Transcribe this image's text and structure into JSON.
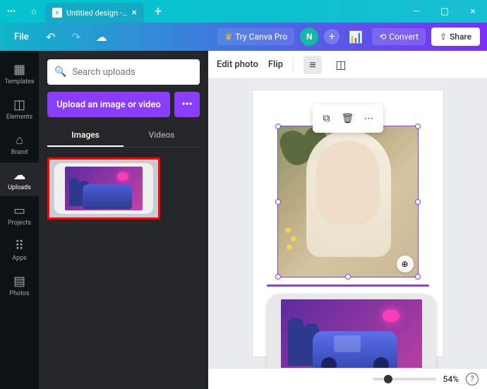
{
  "titlebar": {
    "tab_title": "Untitled design - D...",
    "menu_dots": "•••",
    "close": "×",
    "new_tab": "+",
    "minimize": "—",
    "maximize": "▢",
    "win_close": "×"
  },
  "toolbar": {
    "file": "File",
    "try_pro": "Try Canva Pro",
    "avatar_letter": "N",
    "convert": "Convert",
    "share": "Share"
  },
  "rail": {
    "items": [
      {
        "icon": "▦",
        "label": "Templates"
      },
      {
        "icon": "◫",
        "label": "Elements"
      },
      {
        "icon": "⌂",
        "label": "Brand"
      },
      {
        "icon": "☁",
        "label": "Uploads"
      },
      {
        "icon": "▭",
        "label": "Projects"
      },
      {
        "icon": "⠿",
        "label": "Apps"
      },
      {
        "icon": "▤",
        "label": "Photos"
      }
    ],
    "active_index": 3
  },
  "panel": {
    "search_placeholder": "Search uploads",
    "upload_label": "Upload an image or video",
    "more": "•••",
    "tabs": [
      "Images",
      "Videos"
    ],
    "active_tab": 0,
    "collapse": "‹"
  },
  "context": {
    "edit_photo": "Edit photo",
    "flip": "Flip"
  },
  "float": {
    "copy": "⧉",
    "delete": "🗑",
    "more": "⋯"
  },
  "zoom_badge": "⊕",
  "bottombar": {
    "zoom_pct": "54%",
    "help": "?"
  }
}
